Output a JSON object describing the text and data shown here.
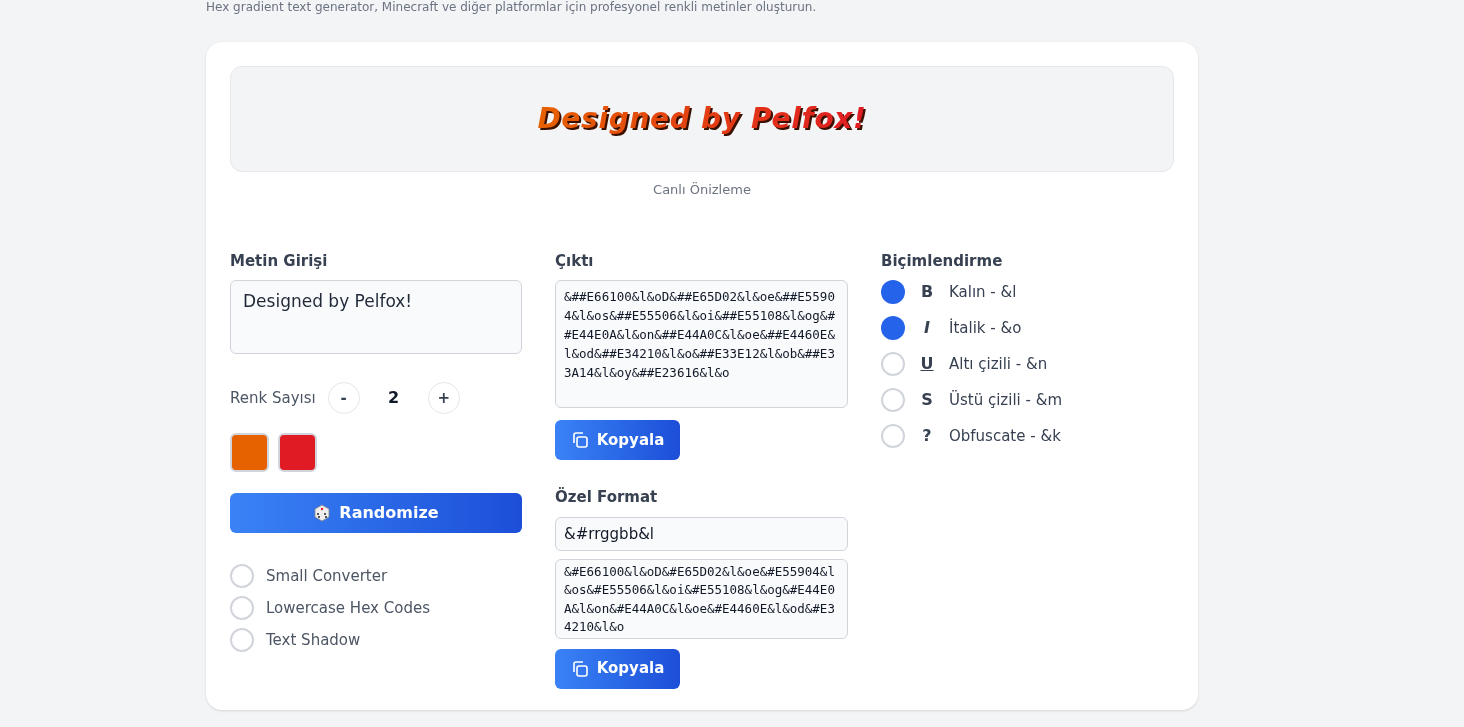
{
  "subtitle": "Hex gradient text generator, Minecraft ve diğer platformlar için profesyonel renkli metinler oluşturun.",
  "preview": {
    "text": "Designed by Pelfox!",
    "caption": "Canlı Önizleme"
  },
  "input": {
    "label": "Metin Girişi",
    "value": "Designed by Pelfox!"
  },
  "color_count": {
    "label": "Renk Sayısı",
    "minus": "-",
    "value": "2",
    "plus": "+"
  },
  "colors": [
    {
      "color": "#e66100"
    },
    {
      "color": "#e01b24"
    }
  ],
  "randomize": {
    "label": "Randomize"
  },
  "options": [
    {
      "label": "Small Converter",
      "checked": false
    },
    {
      "label": "Lowercase Hex Codes",
      "checked": false
    },
    {
      "label": "Text Shadow",
      "checked": false
    }
  ],
  "output": {
    "label": "Çıktı",
    "value": "&##E66100&l&oD&##E65D02&l&oe&##E55904&l&os&##E55506&l&oi&##E55108&l&og&##E44E0A&l&on&##E44A0C&l&oe&##E4460E&l&od&##E34210&l&o&##E33E12&l&ob&##E33A14&l&oy&##E23616&l&o",
    "copy": "Kopyala"
  },
  "custom_format": {
    "label": "Özel Format",
    "pattern": "&#rrggbb&l",
    "value": "&#E66100&l&oD&#E65D02&l&oe&#E55904&l&os&#E55506&l&oi&#E55108&l&og&#E44E0A&l&on&#E44A0C&l&oe&#E4460E&l&od&#E34210&l&o",
    "copy": "Kopyala"
  },
  "formatting": {
    "label": "Biçimlendirme",
    "items": [
      {
        "kind": "bold",
        "symbol": "B",
        "label": "Kalın - &l",
        "checked": true
      },
      {
        "kind": "italic",
        "symbol": "I",
        "label": "İtalik - &o",
        "checked": true
      },
      {
        "kind": "underline",
        "symbol": "U",
        "label": "Altı çizili - &n",
        "checked": false
      },
      {
        "kind": "strike",
        "symbol": "S",
        "label": "Üstü çizili - &m",
        "checked": false
      },
      {
        "kind": "obfuscate",
        "symbol": "?",
        "label": "Obfuscate - &k",
        "checked": false
      }
    ]
  }
}
